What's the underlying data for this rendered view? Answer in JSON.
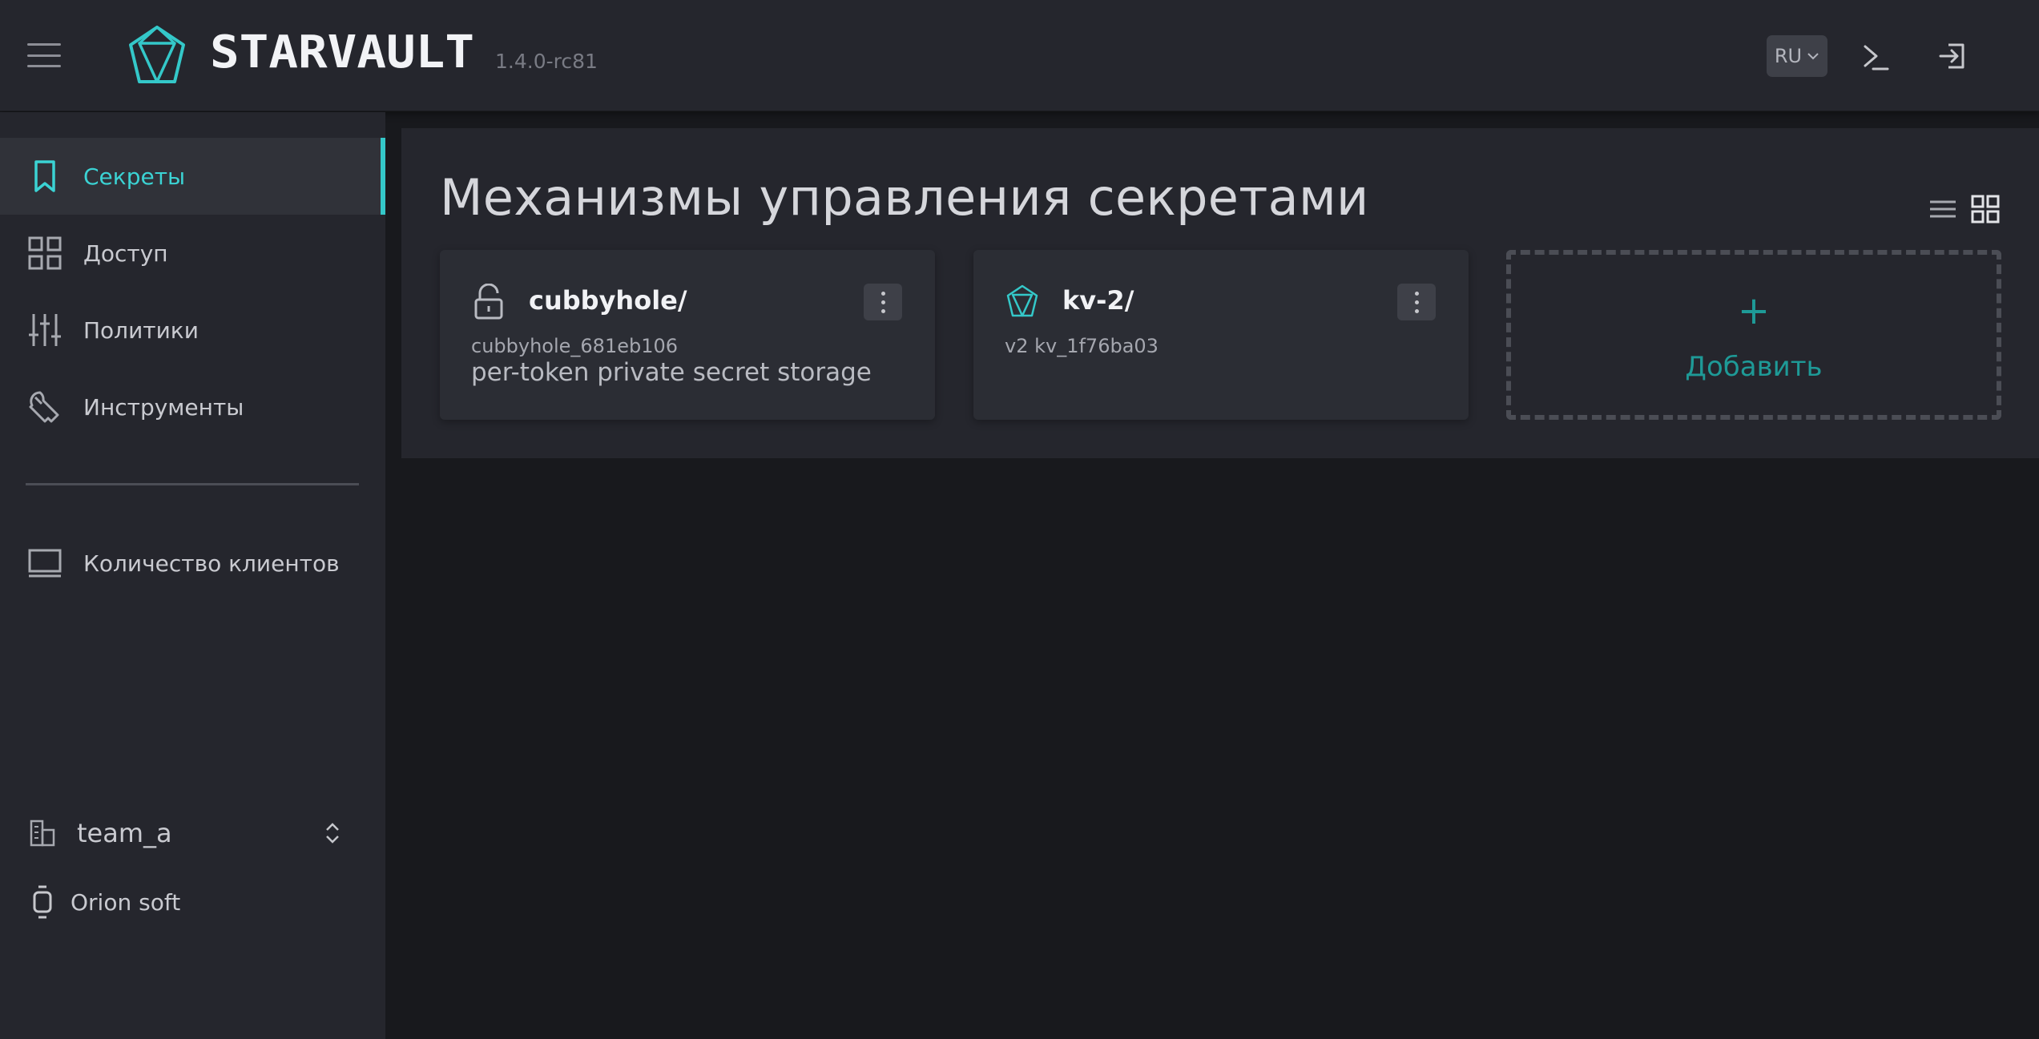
{
  "header": {
    "brand": "STARVAULT",
    "version": "1.4.0-rc81",
    "language": "RU"
  },
  "sidebar": {
    "items": [
      {
        "label": "Секреты",
        "icon": "bookmark-icon",
        "active": true
      },
      {
        "label": "Доступ",
        "icon": "grid-icon",
        "active": false
      },
      {
        "label": "Политики",
        "icon": "sliders-icon",
        "active": false
      },
      {
        "label": "Инструменты",
        "icon": "tools-icon",
        "active": false
      }
    ],
    "secondary": [
      {
        "label": "Количество клиентов",
        "icon": "monitor-icon"
      }
    ],
    "namespace": "team_a",
    "org": "Orion soft"
  },
  "main": {
    "title": "Механизмы управления секретами",
    "cards": [
      {
        "name": "cubbyhole/",
        "accessor": "cubbyhole_681eb106",
        "description": "per-token private secret storage",
        "icon": "unlock-icon"
      },
      {
        "name": "kv-2/",
        "accessor": "v2 kv_1f76ba03",
        "description": "",
        "icon": "kv-logo-icon"
      }
    ],
    "add_label": "Добавить",
    "add_symbol": "+"
  },
  "colors": {
    "accent": "#34c8c9",
    "header_bg": "#25262d",
    "page_bg": "#18191d",
    "add_color": "#1e9a97"
  }
}
